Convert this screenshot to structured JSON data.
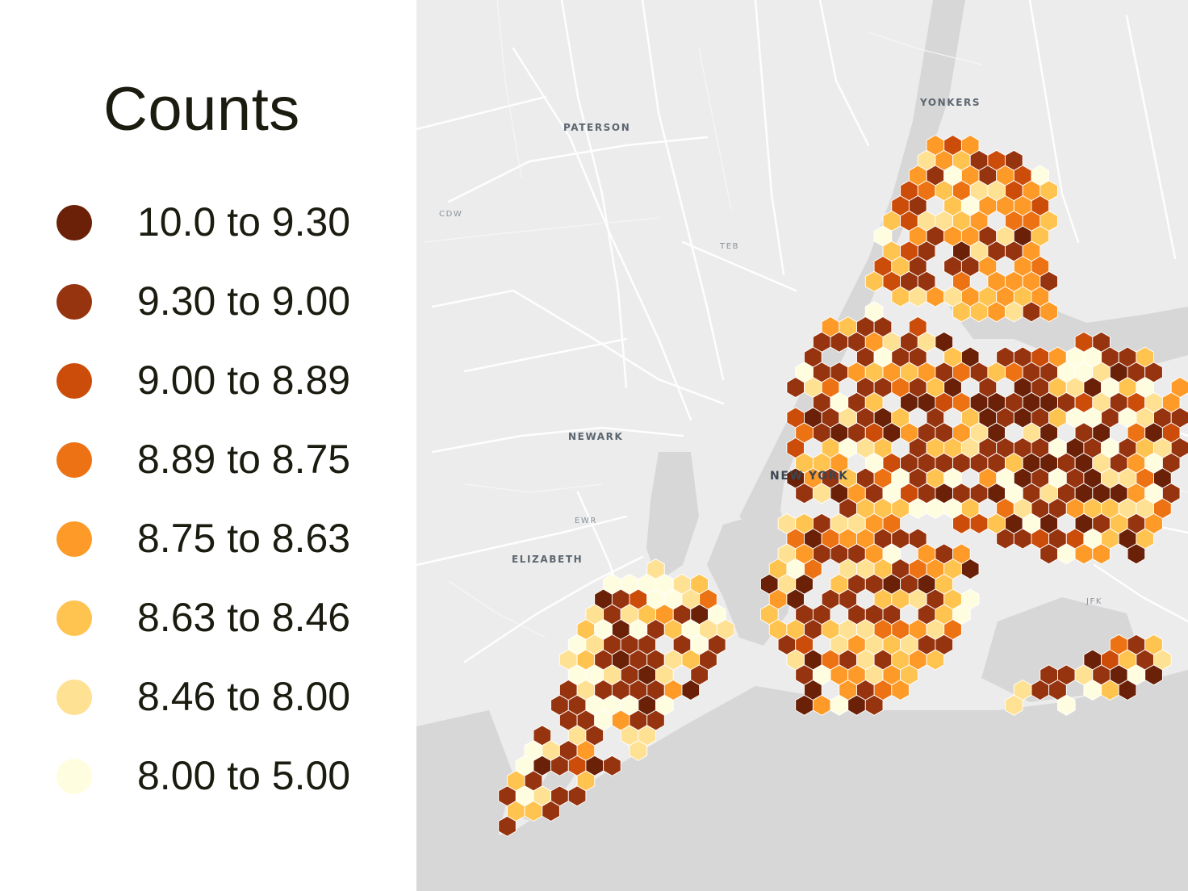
{
  "legend": {
    "title": "Counts",
    "items": [
      {
        "label": "10.0 to 9.30",
        "color": "#6a2108"
      },
      {
        "label": "9.30 to 9.00",
        "color": "#973410"
      },
      {
        "label": "9.00 to 8.89",
        "color": "#cc4c09"
      },
      {
        "label": "8.89 to 8.75",
        "color": "#ec7214"
      },
      {
        "label": "8.75 to 8.63",
        "color": "#fd9a28"
      },
      {
        "label": "8.63 to 8.46",
        "color": "#ffc350"
      },
      {
        "label": "8.46 to 8.00",
        "color": "#ffe194"
      },
      {
        "label": "8.00 to 5.00",
        "color": "#fffde0"
      }
    ]
  },
  "map": {
    "labels": {
      "yonkers": "YONKERS",
      "paterson": "PATERSON",
      "cdw": "CDW",
      "teb": "TEB",
      "newark": "NEWARK",
      "new_york": "NEW YORK",
      "ewr": "EWR",
      "elizabeth": "ELIZABETH",
      "jfk": "JFK"
    },
    "colors": {
      "land": "#ececec",
      "water": "#d6d6d6",
      "roads": "#ffffff"
    }
  }
}
